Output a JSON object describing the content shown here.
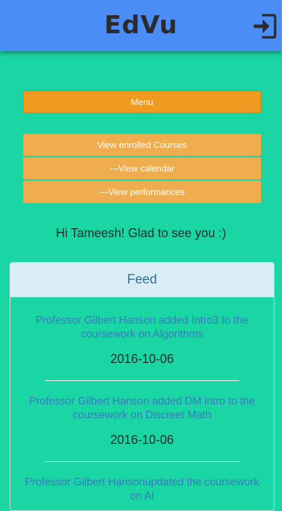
{
  "app": {
    "brand": "EdVu"
  },
  "header": {
    "logout_icon": "sign-in-icon"
  },
  "menu": {
    "toggle_label": "Menu",
    "items": [
      {
        "label": "View enrolled Courses"
      },
      {
        "label": "---View calendar"
      },
      {
        "label": "---View performances"
      }
    ]
  },
  "greeting": "Hi Tameesh! Glad to see you :)",
  "feed": {
    "title": "Feed",
    "items": [
      {
        "text": "Professor Gilbert Hanson added Intro3 to the coursework on Algorithms",
        "date": "2016-10-06"
      },
      {
        "text": "Professor Gilbert Hanson added DM intro to the coursework on Discreet Math",
        "date": "2016-10-06"
      },
      {
        "text": "Professor Gilbert Hansonupdated the coursework on AI",
        "date": ""
      }
    ]
  },
  "colors": {
    "background": "#1ad6a4",
    "topbar": "#4b8df6",
    "menu_button": "#ef9b22",
    "nav_button": "#efad4f",
    "feed_header": "#d9edf7",
    "feed_link": "#3a78c2"
  }
}
